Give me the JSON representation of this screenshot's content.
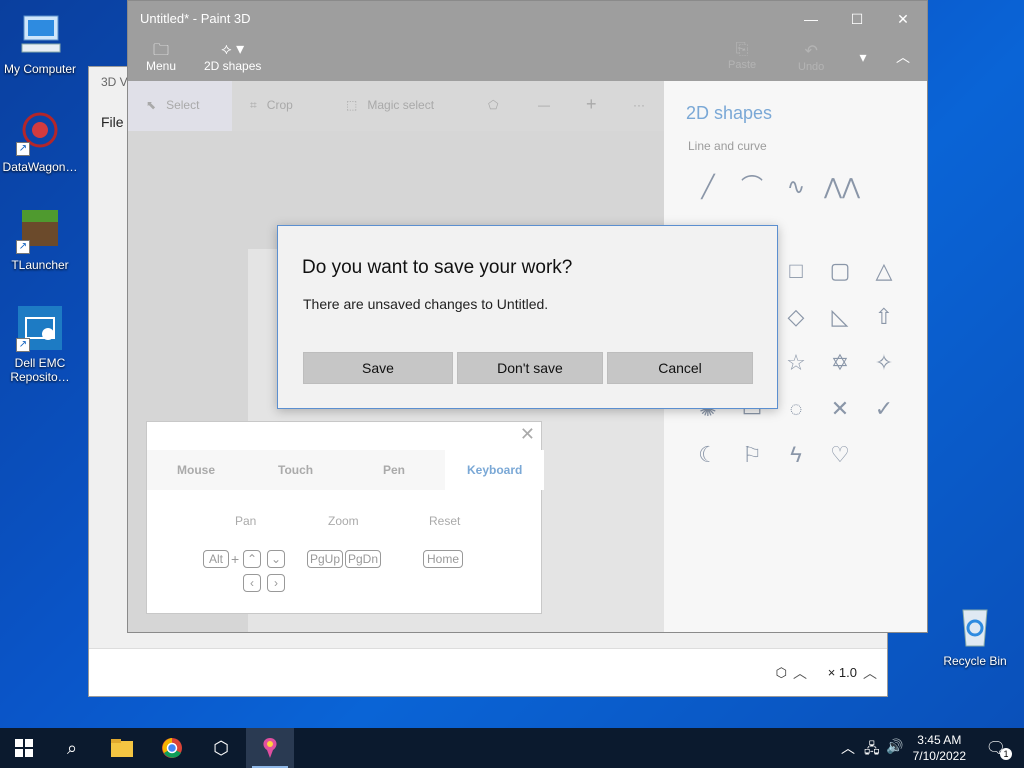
{
  "desktop": {
    "icons": [
      {
        "label": "My Computer"
      },
      {
        "label": "DataWagon…"
      },
      {
        "label": "TLauncher"
      },
      {
        "label": "Dell EMC Reposito…"
      },
      {
        "label": "Recycle Bin"
      }
    ]
  },
  "viewer": {
    "title": "3D Vi",
    "menu_file": "File",
    "zoom": "× 1.0"
  },
  "paint": {
    "title": "Untitled* - Paint 3D",
    "toolbar": {
      "menu": "Menu",
      "shapes": "2D shapes",
      "paste": "Paste",
      "undo": "Undo"
    },
    "tools": {
      "select": "Select",
      "crop": "Crop",
      "magic_select": "Magic select"
    },
    "side": {
      "title": "2D shapes",
      "subtitle": "Line and curve"
    }
  },
  "dialog": {
    "title": "Do you want to save your work?",
    "message": "There are unsaved changes to Untitled.",
    "save": "Save",
    "dont_save": "Don't save",
    "cancel": "Cancel"
  },
  "help_panel": {
    "tabs": [
      "Mouse",
      "Touch",
      "Pen",
      "Keyboard"
    ],
    "labels": {
      "pan": "Pan",
      "zoom": "Zoom",
      "reset": "Reset"
    },
    "keys": {
      "alt": "Alt",
      "plus": "+",
      "pgup": "PgUp",
      "pgdn": "PgDn",
      "home": "Home"
    }
  },
  "taskbar": {
    "time": "3:45 AM",
    "date": "7/10/2022",
    "notifications": "1"
  }
}
